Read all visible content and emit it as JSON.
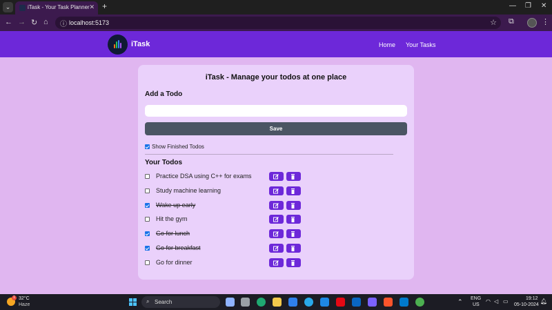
{
  "browser": {
    "tab_title": "iTask - Your Task Planner",
    "url": "localhost:5173"
  },
  "navbar": {
    "brand": "iTask",
    "links": [
      "Home",
      "Your Tasks"
    ]
  },
  "card": {
    "title": "iTask - Manage your todos at one place",
    "add_heading": "Add a Todo",
    "input_value": "",
    "save_label": "Save",
    "show_finished_label": "Show Finished Todos",
    "show_finished_checked": true,
    "your_todos_heading": "Your Todos"
  },
  "todos": [
    {
      "text": "Practice DSA using C++ for exams",
      "done": false
    },
    {
      "text": "Study machine learning",
      "done": false
    },
    {
      "text": "Wake up early",
      "done": true
    },
    {
      "text": "Hit the gym",
      "done": false
    },
    {
      "text": "Go for lunch",
      "done": true
    },
    {
      "text": "Go for breakfast",
      "done": true
    },
    {
      "text": "Go for dinner",
      "done": false
    }
  ],
  "taskbar": {
    "weather_temp": "32°C",
    "weather_desc": "Haze",
    "weather_badge": "1",
    "search_label": "Search",
    "lang": "ENG",
    "region": "US",
    "time": "19:12",
    "date": "05-10-2024"
  },
  "colors": {
    "accent": "#6d28d9",
    "page_bg": "#e0b6f0",
    "card_bg": "#ead1fb",
    "save_button": "#4b5563"
  }
}
